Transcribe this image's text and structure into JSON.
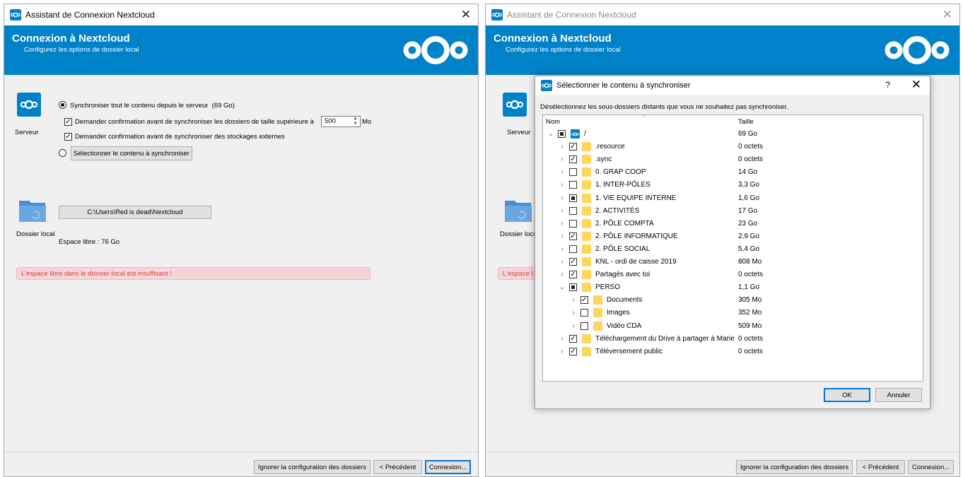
{
  "brand_color": "#0082c9",
  "left_window": {
    "title": "Assistant de Connexion Nextcloud",
    "close_icon": "close-icon",
    "banner": {
      "title": "Connexion à Nextcloud",
      "subtitle": "Configurez les options de dossier local"
    },
    "server": {
      "label": "Serveur",
      "sync_all_label": "Synchroniser tout le contenu depuis le serveur",
      "sync_all_size": "(69 Go)",
      "confirm_large_label": "Demander confirmation avant de synchroniser les dossiers de taille supérieure à",
      "confirm_large_value": "500",
      "confirm_large_unit": "Mo",
      "confirm_external_label": "Demander confirmation avant de synchroniser des stockages externes",
      "select_content_label": "Sélectionner le contenu à synchroniser"
    },
    "local": {
      "label": "Dossier local",
      "path": "C:\\Users\\Red is dead\\Nextcloud",
      "free_space": "Espace libre : 76 Go"
    },
    "warning": "L'espace libre dans le dossier local est insuffisant !",
    "footer": {
      "skip": "Ignorer la configuration des dossiers",
      "back": "< Précédent",
      "connect": "Connexion..."
    }
  },
  "right_window": {
    "title": "Assistant de Connexion Nextcloud",
    "banner": {
      "title": "Connexion à Nextcloud",
      "subtitle": "Configurez les options de dossier local"
    },
    "server_label": "Serveur",
    "local_label": "Dossier loca",
    "warning": "L'espace l",
    "footer": {
      "skip": "Ignorer la configuration des dossiers",
      "back": "< Précédent",
      "connect": "Connexion..."
    }
  },
  "dialog": {
    "title": "Sélectionner le contenu à synchroniser",
    "help": "?",
    "description": "Désélectionnez les sous-dossiers distants que vous ne souhaitez pas synchroniser.",
    "col_name": "Nom",
    "col_size": "Taille",
    "rows": [
      {
        "name": "/",
        "size": "69 Go",
        "level": 0,
        "state": "partial",
        "expanded": true,
        "root": true
      },
      {
        "name": ".resource",
        "size": "0 octets",
        "level": 1,
        "state": "checked",
        "expanded": false
      },
      {
        "name": ".sync",
        "size": "0 octets",
        "level": 1,
        "state": "checked",
        "expanded": false
      },
      {
        "name": "0. GRAP COOP",
        "size": "14 Go",
        "level": 1,
        "state": "unchecked",
        "expanded": false
      },
      {
        "name": "1. INTER-PÔLES",
        "size": "3,3 Go",
        "level": 1,
        "state": "unchecked",
        "expanded": false
      },
      {
        "name": "1. VIE EQUIPE INTERNE",
        "size": "1,6 Go",
        "level": 1,
        "state": "partial",
        "expanded": false
      },
      {
        "name": "2. ACTIVITÉS",
        "size": "17 Go",
        "level": 1,
        "state": "unchecked",
        "expanded": false
      },
      {
        "name": "2. PÔLE COMPTA",
        "size": "23 Go",
        "level": 1,
        "state": "unchecked",
        "expanded": false
      },
      {
        "name": "2. PÔLE INFORMATIQUE",
        "size": "2,9 Go",
        "level": 1,
        "state": "checked",
        "expanded": false
      },
      {
        "name": "2. PÔLE SOCIAL",
        "size": "5,4 Go",
        "level": 1,
        "state": "unchecked",
        "expanded": false
      },
      {
        "name": "KNL - ordi de caisse 2019",
        "size": "808 Mo",
        "level": 1,
        "state": "checked",
        "expanded": false
      },
      {
        "name": "Partagés avec toi",
        "size": "0 octets",
        "level": 1,
        "state": "checked",
        "expanded": false
      },
      {
        "name": "PERSO",
        "size": "1,1 Go",
        "level": 1,
        "state": "partial",
        "expanded": true
      },
      {
        "name": "Documents",
        "size": "305 Mo",
        "level": 2,
        "state": "checked",
        "expanded": false
      },
      {
        "name": "Images",
        "size": "352 Mo",
        "level": 2,
        "state": "unchecked",
        "expanded": false
      },
      {
        "name": "Vidéo CDA",
        "size": "509 Mo",
        "level": 2,
        "state": "unchecked",
        "expanded": false
      },
      {
        "name": "Téléchargement du Drive à partager à Marie",
        "size": "0 octets",
        "level": 1,
        "state": "checked",
        "expanded": false
      },
      {
        "name": "Téléversement public",
        "size": "0 octets",
        "level": 1,
        "state": "checked",
        "expanded": false
      }
    ],
    "ok": "OK",
    "cancel": "Annuler"
  }
}
